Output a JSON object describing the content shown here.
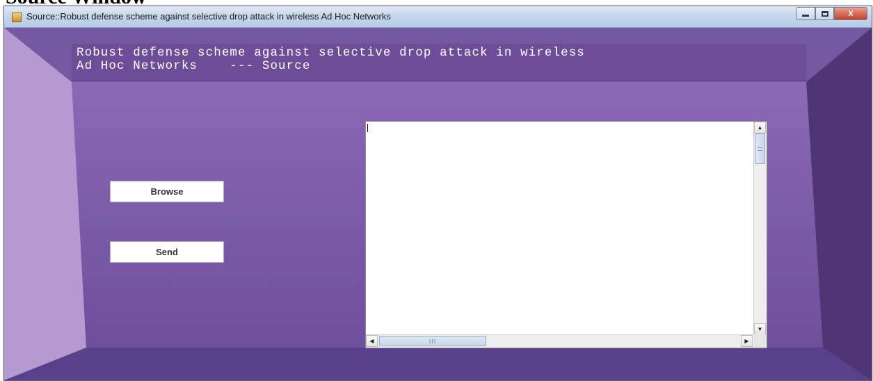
{
  "caption": {
    "text": "Source Window"
  },
  "window": {
    "title": "Source::Robust defense scheme against selective drop attack in wireless Ad Hoc Networks",
    "app_icon": "java-app-icon",
    "controls": {
      "minimize_icon": "minimize-icon",
      "maximize_icon": "maximize-icon",
      "close_glyph": "X"
    }
  },
  "header": {
    "text": "Robust defense scheme against selective drop attack in wireless\nAd Hoc Networks    --- Source"
  },
  "buttons": {
    "browse_label": "Browse",
    "send_label": "Send"
  },
  "textarea": {
    "value": "",
    "scroll": {
      "up_glyph": "▲",
      "down_glyph": "▼",
      "left_glyph": "◀",
      "right_glyph": "▶",
      "thumb_grip": "III"
    }
  },
  "colors": {
    "background_purple": "#7d5fa9",
    "header_band": "#6c4d96",
    "titlebar": "#c4d6ec",
    "close_button": "#c43f2a"
  }
}
